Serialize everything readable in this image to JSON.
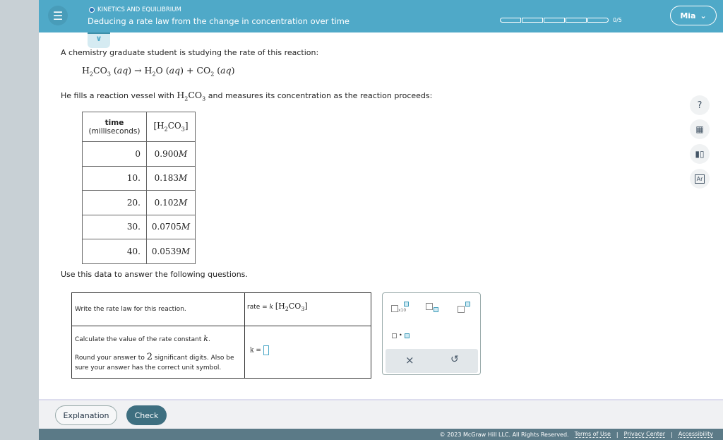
{
  "header": {
    "topic": "KINETICS AND EQUILIBRIUM",
    "title": "Deducing a rate law from the change in concentration over time",
    "progress": "0/5",
    "progress_value": 0,
    "progress_total": 5,
    "user": "Mia"
  },
  "problem": {
    "intro": "A chemistry graduate student is studying the rate of this reaction:",
    "fill_prefix": "He fills a reaction vessel with",
    "fill_suffix": "and measures its concentration as the reaction proceeds:",
    "use_data": "Use this data to answer the following questions."
  },
  "table": {
    "col1": "time",
    "col1_unit": "(milliseconds)",
    "rows": [
      {
        "t": "0",
        "c": "0.900"
      },
      {
        "t": "10.",
        "c": "0.183"
      },
      {
        "t": "20.",
        "c": "0.102"
      },
      {
        "t": "30.",
        "c": "0.0705"
      },
      {
        "t": "40.",
        "c": "0.0539"
      }
    ],
    "unit": "M"
  },
  "questions": {
    "q1": "Write the rate law for this reaction.",
    "q1_answer_prefix": "rate",
    "q1_k": "k",
    "q2a": "Calculate the value of the rate constant",
    "q2_k": "k",
    "q2b_pre": "Round your answer to",
    "q2b_num": "2",
    "q2b_post": "significant digits. Also be sure your answer has the correct unit symbol.",
    "q2_answer_prefix": "k ="
  },
  "tools": {
    "x10": "x10",
    "clear": "×",
    "undo": "↺"
  },
  "sidebar": {
    "help": "?"
  },
  "footer": {
    "explanation": "Explanation",
    "check": "Check",
    "copyright": "© 2023 McGraw Hill LLC. All Rights Reserved.",
    "terms": "Terms of Use",
    "privacy": "Privacy Center",
    "accessibility": "Accessibility"
  },
  "colors": {
    "header": "#4fa9c8",
    "check_button": "#3e6f80",
    "footer": "#5b7a87"
  }
}
